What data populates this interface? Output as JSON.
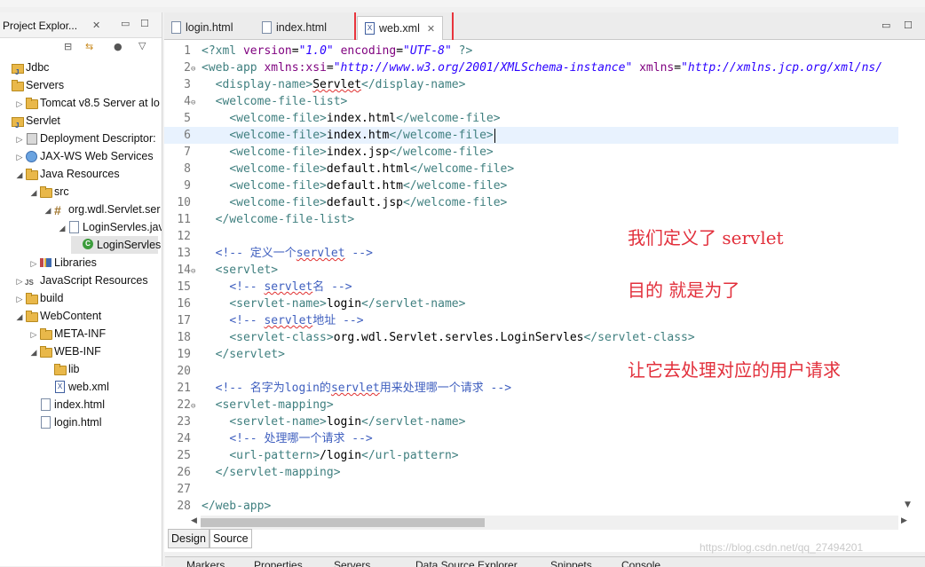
{
  "explorer": {
    "title": "Project Explor...",
    "close": "✕",
    "items": [
      {
        "label": "Jdbc",
        "icon": "project-icon",
        "indent": 0,
        "twisty": ""
      },
      {
        "label": "Servers",
        "icon": "folder-icon",
        "indent": 0,
        "twisty": ""
      },
      {
        "label": "Tomcat v8.5 Server at lo",
        "icon": "folder-icon",
        "indent": 1,
        "twisty": "▷"
      },
      {
        "label": "Servlet",
        "icon": "project-icon",
        "indent": 0,
        "twisty": ""
      },
      {
        "label": "Deployment Descriptor:",
        "icon": "descriptor-icon",
        "indent": 1,
        "twisty": "▷"
      },
      {
        "label": "JAX-WS Web Services",
        "icon": "web-services-icon",
        "indent": 1,
        "twisty": "▷"
      },
      {
        "label": "Java Resources",
        "icon": "java-resources-icon",
        "indent": 1,
        "twisty": "◢"
      },
      {
        "label": "src",
        "icon": "source-folder-icon",
        "indent": 2,
        "twisty": "◢"
      },
      {
        "label": "org.wdl.Servlet.ser",
        "icon": "package-icon",
        "indent": 3,
        "twisty": "◢"
      },
      {
        "label": "LoginServles.jav",
        "icon": "java-file-icon",
        "indent": 4,
        "twisty": "◢"
      },
      {
        "label": "LoginServles",
        "icon": "class-icon",
        "indent": 5,
        "twisty": "",
        "selected": true
      },
      {
        "label": "Libraries",
        "icon": "libraries-icon",
        "indent": 2,
        "twisty": "▷"
      },
      {
        "label": "JavaScript Resources",
        "icon": "javascript-icon",
        "indent": 1,
        "twisty": "▷"
      },
      {
        "label": "build",
        "icon": "folder-icon",
        "indent": 1,
        "twisty": "▷"
      },
      {
        "label": "WebContent",
        "icon": "folder-icon",
        "indent": 1,
        "twisty": "◢"
      },
      {
        "label": "META-INF",
        "icon": "folder-icon",
        "indent": 2,
        "twisty": "▷"
      },
      {
        "label": "WEB-INF",
        "icon": "folder-icon",
        "indent": 2,
        "twisty": "◢"
      },
      {
        "label": "lib",
        "icon": "folder-icon",
        "indent": 3,
        "twisty": ""
      },
      {
        "label": "web.xml",
        "icon": "xml-file-icon",
        "indent": 3,
        "twisty": ""
      },
      {
        "label": "index.html",
        "icon": "html-file-icon",
        "indent": 2,
        "twisty": ""
      },
      {
        "label": "login.html",
        "icon": "html-file-icon",
        "indent": 2,
        "twisty": ""
      }
    ]
  },
  "editor": {
    "tabs": [
      {
        "label": "login.html",
        "icon": "html-file-icon"
      },
      {
        "label": "index.html",
        "icon": "html-file-icon"
      },
      {
        "label": "web.xml",
        "icon": "xml-file-icon",
        "active": true
      }
    ],
    "tab_close": "✕",
    "minimize": "▭",
    "maximize": "☐",
    "current_line": 6,
    "lines": [
      {
        "n": "1",
        "fold": "",
        "segs": [
          [
            "t",
            "<?xml "
          ],
          [
            "a",
            "version"
          ],
          [
            "tx",
            "="
          ],
          [
            "v",
            "\"1.0\""
          ],
          [
            "tx",
            " "
          ],
          [
            "a",
            "encoding"
          ],
          [
            "tx",
            "="
          ],
          [
            "v",
            "\"UTF-8\""
          ],
          [
            "t",
            " ?>"
          ]
        ]
      },
      {
        "n": "2",
        "fold": "⊖",
        "segs": [
          [
            "t",
            "<web-app "
          ],
          [
            "a",
            "xmlns:xsi"
          ],
          [
            "tx",
            "="
          ],
          [
            "v",
            "\"http://www.w3.org/2001/XMLSchema-instance\""
          ],
          [
            "tx",
            " "
          ],
          [
            "a",
            "xmlns"
          ],
          [
            "tx",
            "="
          ],
          [
            "v",
            "\"http://xmlns.jcp.org/xml/ns/"
          ]
        ]
      },
      {
        "n": "3",
        "fold": "",
        "segs": [
          [
            "tx",
            "  "
          ],
          [
            "t",
            "<display-name>"
          ],
          [
            "tx sq",
            "Servlet"
          ],
          [
            "t",
            "</display-name>"
          ]
        ]
      },
      {
        "n": "4",
        "fold": "⊖",
        "segs": [
          [
            "tx",
            "  "
          ],
          [
            "t",
            "<welcome-file-list>"
          ]
        ]
      },
      {
        "n": "5",
        "fold": "",
        "segs": [
          [
            "tx",
            "    "
          ],
          [
            "t",
            "<welcome-file>"
          ],
          [
            "tx",
            "index.html"
          ],
          [
            "t",
            "</welcome-file>"
          ]
        ]
      },
      {
        "n": "6",
        "fold": "",
        "segs": [
          [
            "tx",
            "    "
          ],
          [
            "t",
            "<welcome-file>"
          ],
          [
            "tx",
            "index.htm"
          ],
          [
            "t",
            "</welcome-file>"
          ]
        ]
      },
      {
        "n": "7",
        "fold": "",
        "segs": [
          [
            "tx",
            "    "
          ],
          [
            "t",
            "<welcome-file>"
          ],
          [
            "tx",
            "index.jsp"
          ],
          [
            "t",
            "</welcome-file>"
          ]
        ]
      },
      {
        "n": "8",
        "fold": "",
        "segs": [
          [
            "tx",
            "    "
          ],
          [
            "t",
            "<welcome-file>"
          ],
          [
            "tx",
            "default.html"
          ],
          [
            "t",
            "</welcome-file>"
          ]
        ]
      },
      {
        "n": "9",
        "fold": "",
        "segs": [
          [
            "tx",
            "    "
          ],
          [
            "t",
            "<welcome-file>"
          ],
          [
            "tx",
            "default.htm"
          ],
          [
            "t",
            "</welcome-file>"
          ]
        ]
      },
      {
        "n": "10",
        "fold": "",
        "segs": [
          [
            "tx",
            "    "
          ],
          [
            "t",
            "<welcome-file>"
          ],
          [
            "tx",
            "default.jsp"
          ],
          [
            "t",
            "</welcome-file>"
          ]
        ]
      },
      {
        "n": "11",
        "fold": "",
        "segs": [
          [
            "tx",
            "  "
          ],
          [
            "t",
            "</welcome-file-list>"
          ]
        ]
      },
      {
        "n": "12",
        "fold": "",
        "segs": []
      },
      {
        "n": "13",
        "fold": "",
        "segs": [
          [
            "tx",
            "  "
          ],
          [
            "c",
            "<!-- 定义一个"
          ],
          [
            "c sq",
            "servlet"
          ],
          [
            "c",
            " -->"
          ]
        ]
      },
      {
        "n": "14",
        "fold": "⊖",
        "segs": [
          [
            "tx",
            "  "
          ],
          [
            "t",
            "<servlet>"
          ]
        ]
      },
      {
        "n": "15",
        "fold": "",
        "segs": [
          [
            "tx",
            "    "
          ],
          [
            "c",
            "<!-- "
          ],
          [
            "c sq",
            "servlet"
          ],
          [
            "c",
            "名 -->"
          ]
        ]
      },
      {
        "n": "16",
        "fold": "",
        "segs": [
          [
            "tx",
            "    "
          ],
          [
            "t",
            "<servlet-name>"
          ],
          [
            "tx",
            "login"
          ],
          [
            "t",
            "</servlet-name>"
          ]
        ]
      },
      {
        "n": "17",
        "fold": "",
        "segs": [
          [
            "tx",
            "    "
          ],
          [
            "c",
            "<!-- "
          ],
          [
            "c sq",
            "servlet"
          ],
          [
            "c",
            "地址 -->"
          ]
        ]
      },
      {
        "n": "18",
        "fold": "",
        "segs": [
          [
            "tx",
            "    "
          ],
          [
            "t",
            "<servlet-class>"
          ],
          [
            "tx",
            "org.wdl.Servlet.servles.LoginServles"
          ],
          [
            "t",
            "</servlet-class>"
          ]
        ]
      },
      {
        "n": "19",
        "fold": "",
        "segs": [
          [
            "tx",
            "  "
          ],
          [
            "t",
            "</servlet>"
          ]
        ]
      },
      {
        "n": "20",
        "fold": "",
        "segs": []
      },
      {
        "n": "21",
        "fold": "",
        "segs": [
          [
            "tx",
            "  "
          ],
          [
            "c",
            "<!-- 名字为login的"
          ],
          [
            "c sq",
            "servlet"
          ],
          [
            "c",
            "用来处理哪一个请求 -->"
          ]
        ]
      },
      {
        "n": "22",
        "fold": "⊖",
        "segs": [
          [
            "tx",
            "  "
          ],
          [
            "t",
            "<servlet-mapping>"
          ]
        ]
      },
      {
        "n": "23",
        "fold": "",
        "segs": [
          [
            "tx",
            "    "
          ],
          [
            "t",
            "<servlet-name>"
          ],
          [
            "tx",
            "login"
          ],
          [
            "t",
            "</servlet-name>"
          ]
        ]
      },
      {
        "n": "24",
        "fold": "",
        "segs": [
          [
            "tx",
            "    "
          ],
          [
            "c",
            "<!-- 处理哪一个请求 -->"
          ]
        ]
      },
      {
        "n": "25",
        "fold": "",
        "segs": [
          [
            "tx",
            "    "
          ],
          [
            "t",
            "<url-pattern>"
          ],
          [
            "tx",
            "/login"
          ],
          [
            "t",
            "</url-pattern>"
          ]
        ]
      },
      {
        "n": "26",
        "fold": "",
        "segs": [
          [
            "tx",
            "  "
          ],
          [
            "t",
            "</servlet-mapping>"
          ]
        ]
      },
      {
        "n": "27",
        "fold": "",
        "segs": []
      },
      {
        "n": "28",
        "fold": "",
        "segs": [
          [
            "t",
            "</web-app>"
          ]
        ]
      }
    ],
    "notes": [
      "我们定义了 servlet",
      "目的 就是为了",
      "让它去处理对应的用户请求"
    ]
  },
  "bottom_tabs": {
    "design": "Design",
    "source": "Source"
  },
  "views": [
    "Markers",
    "Properties",
    "Servers",
    "Data Source Explorer",
    "Snippets",
    "Console"
  ],
  "watermark": "https://blog.csdn.net/qq_27494201",
  "colors": {
    "annotation_red": "#e2303c",
    "xml_tag": "#3f7f7f",
    "xml_attr": "#7f007f",
    "xml_value": "#2a00ff",
    "xml_comment": "#3f5fbf"
  }
}
